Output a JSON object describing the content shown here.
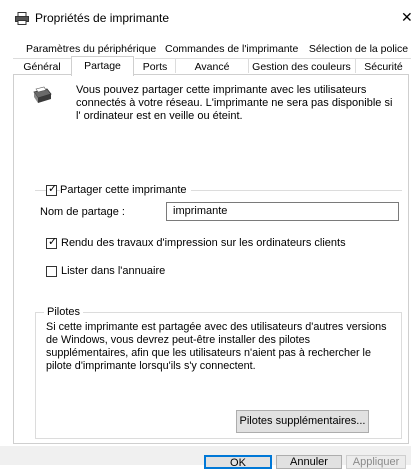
{
  "window": {
    "title": "Propriétés de imprimante",
    "close_glyph": "✕"
  },
  "tabs": {
    "row1": [
      "Paramètres du périphérique",
      "Commandes de l'imprimante",
      "Sélection de la police"
    ],
    "row2": [
      "Général",
      "Partage",
      "Ports",
      "Avancé",
      "Gestion des couleurs",
      "Sécurité"
    ],
    "active": "Partage"
  },
  "intro_text": "Vous pouvez partager cette imprimante avec les utilisateurs connectés à votre réseau. L'imprimante ne sera pas disponible si l' ordinateur est en veille ou éteint.",
  "share": {
    "checkbox_label": "Partager cette imprimante",
    "checked": true,
    "name_label": "Nom de partage :",
    "name_value": "imprimante"
  },
  "render_jobs": {
    "label": "Rendu des travaux d'impression sur les ordinateurs clients",
    "checked": true
  },
  "list_directory": {
    "label": "Lister dans l'annuaire",
    "checked": false
  },
  "drivers": {
    "title": "Pilotes",
    "text": "Si cette imprimante est partagée avec des utilisateurs d'autres versions de Windows, vous devrez peut-être installer des pilotes supplémentaires, afin que les utilisateurs n'aient pas à rechercher le pilote d'imprimante lorsqu'ils s'y connectent.",
    "button_label": "Pilotes supplémentaires..."
  },
  "footer": {
    "ok": "OK",
    "cancel": "Annuler",
    "apply": "Appliquer"
  },
  "icons": {
    "window": "printer-icon",
    "share_info": "printer-icon",
    "check": "✓"
  },
  "colors": {
    "accent": "#0078d7",
    "button_bg": "#e1e1e1",
    "border": "#cfcfcf"
  }
}
